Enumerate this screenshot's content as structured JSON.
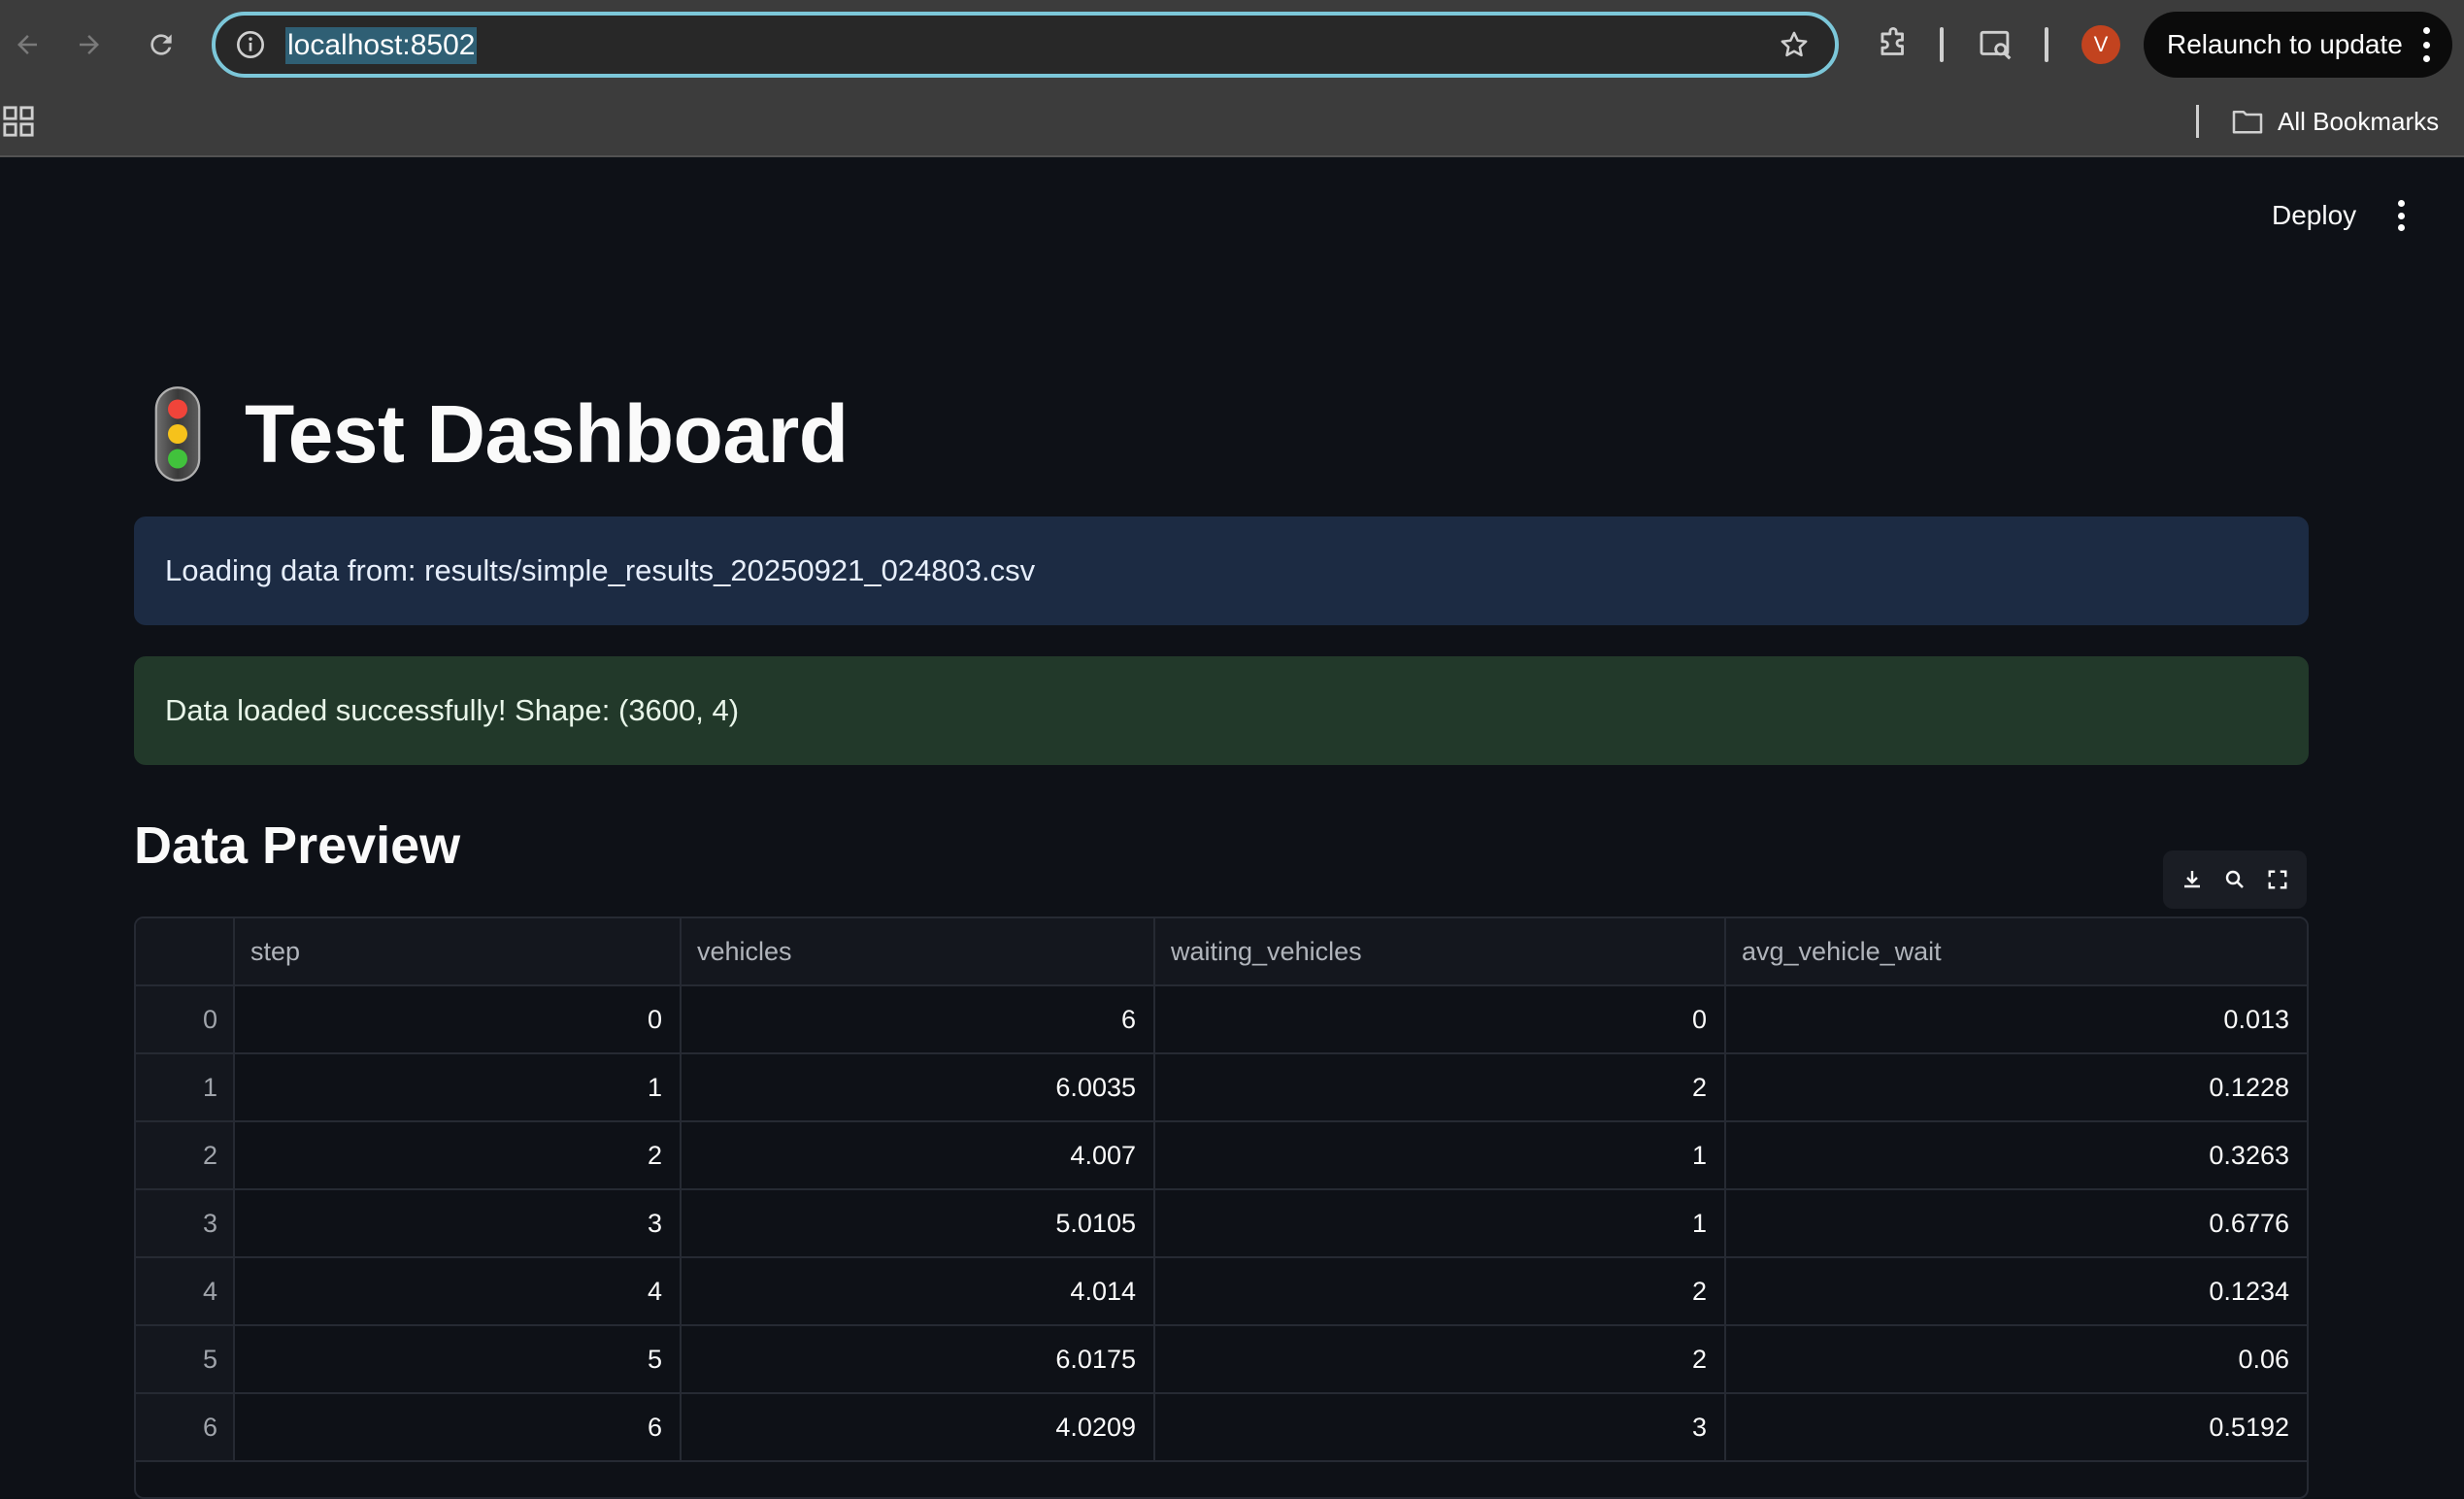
{
  "browser": {
    "url": "localhost:8502",
    "relaunch_label": "Relaunch to update",
    "profile_initial": "V",
    "all_bookmarks_label": "All Bookmarks"
  },
  "app": {
    "deploy_label": "Deploy",
    "title_icon": "traffic-light-icon",
    "title": "Test Dashboard",
    "info_message": "Loading data from: results/simple_results_20250921_024803.csv",
    "success_message": "Data loaded successfully! Shape: (3600, 4)",
    "section_title": "Data Preview"
  },
  "table": {
    "columns": [
      "step",
      "vehicles",
      "waiting_vehicles",
      "avg_vehicle_wait"
    ],
    "rows": [
      {
        "index": "0",
        "step": "0",
        "vehicles": "6",
        "waiting_vehicles": "0",
        "avg_vehicle_wait": "0.013"
      },
      {
        "index": "1",
        "step": "1",
        "vehicles": "6.0035",
        "waiting_vehicles": "2",
        "avg_vehicle_wait": "0.1228"
      },
      {
        "index": "2",
        "step": "2",
        "vehicles": "4.007",
        "waiting_vehicles": "1",
        "avg_vehicle_wait": "0.3263"
      },
      {
        "index": "3",
        "step": "3",
        "vehicles": "5.0105",
        "waiting_vehicles": "1",
        "avg_vehicle_wait": "0.6776"
      },
      {
        "index": "4",
        "step": "4",
        "vehicles": "4.014",
        "waiting_vehicles": "2",
        "avg_vehicle_wait": "0.1234"
      },
      {
        "index": "5",
        "step": "5",
        "vehicles": "6.0175",
        "waiting_vehicles": "2",
        "avg_vehicle_wait": "0.06"
      },
      {
        "index": "6",
        "step": "6",
        "vehicles": "4.0209",
        "waiting_vehicles": "3",
        "avg_vehicle_wait": "0.5192"
      }
    ]
  },
  "colors": {
    "background": "#0e1117",
    "info_bg": "#1c2b43",
    "success_bg": "#22392a",
    "omnibox_focus": "#7cc7d9",
    "profile_bg": "#c2431f"
  }
}
